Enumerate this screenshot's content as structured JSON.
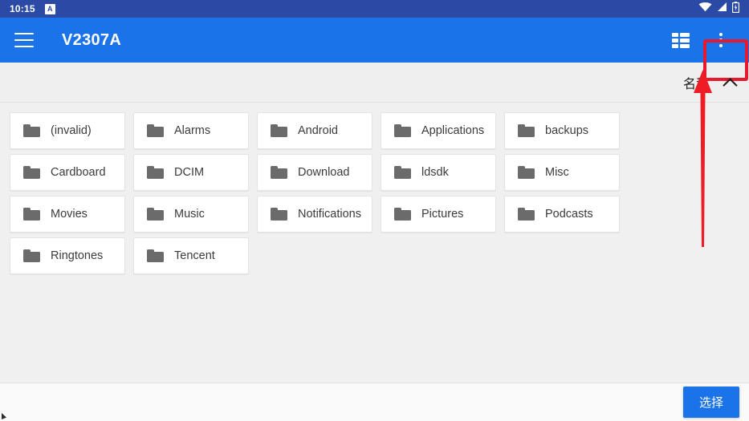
{
  "status_bar": {
    "time": "10:15",
    "notification_icon_letter": "A",
    "icons": [
      "wifi-icon",
      "signal-icon",
      "battery-icon"
    ]
  },
  "app_bar": {
    "menu_icon": "hamburger-menu-icon",
    "title": "V2307A",
    "grid_view_icon": "grid-view-icon",
    "overflow_icon": "overflow-menu-icon"
  },
  "sort_bar": {
    "label": "名称",
    "direction_icon": "chevron-up-icon"
  },
  "folders": [
    {
      "name": "(invalid)"
    },
    {
      "name": "Alarms"
    },
    {
      "name": "Android"
    },
    {
      "name": "Applications"
    },
    {
      "name": "backups"
    },
    {
      "name": "Cardboard"
    },
    {
      "name": "DCIM"
    },
    {
      "name": "Download"
    },
    {
      "name": "ldsdk"
    },
    {
      "name": "Misc"
    },
    {
      "name": "Movies"
    },
    {
      "name": "Music"
    },
    {
      "name": "Notifications"
    },
    {
      "name": "Pictures"
    },
    {
      "name": "Podcasts"
    },
    {
      "name": "Ringtones"
    },
    {
      "name": "Tencent"
    }
  ],
  "bottom_bar": {
    "select_label": "选择"
  },
  "annotations": {
    "highlight_color": "#e8192c",
    "arrow_color": "#ee1c24",
    "target": "overflow-menu-icon"
  },
  "colors": {
    "status_bar": "#2b4aa6",
    "app_bar": "#1a73e8",
    "accent": "#1a73e8",
    "content_bg": "#f0f0f0",
    "card_bg": "#ffffff"
  }
}
